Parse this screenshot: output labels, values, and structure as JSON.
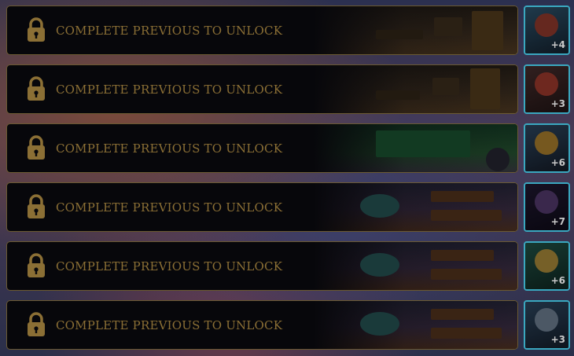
{
  "stages": [
    {
      "label": "COMPLETE PREVIOUS TO UNLOCK",
      "scene": "library",
      "count": "+4",
      "portrait_colors": [
        "#3a6a8a",
        "#b84a3a"
      ]
    },
    {
      "label": "COMPLETE PREVIOUS TO UNLOCK",
      "scene": "library",
      "count": "+3",
      "portrait_colors": [
        "#5a3a3a",
        "#c84a3a"
      ]
    },
    {
      "label": "COMPLETE PREVIOUS TO UNLOCK",
      "scene": "chalk",
      "count": "+6",
      "portrait_colors": [
        "#3a5a7a",
        "#d8a03a"
      ]
    },
    {
      "label": "COMPLETE PREVIOUS TO UNLOCK",
      "scene": "classroom",
      "count": "+7",
      "portrait_colors": [
        "#2a2040",
        "#6a4a8a"
      ]
    },
    {
      "label": "COMPLETE PREVIOUS TO UNLOCK",
      "scene": "classroom",
      "count": "+6",
      "portrait_colors": [
        "#2a6a5a",
        "#d8b04a"
      ]
    },
    {
      "label": "COMPLETE PREVIOUS TO UNLOCK",
      "scene": "classroom",
      "count": "+3",
      "portrait_colors": [
        "#3a5a7a",
        "#8aa0b8"
      ]
    }
  ],
  "colors": {
    "frame_border": "#6b5a32",
    "label_text": "#8b6f35",
    "lock_icon": "#8b6f35",
    "portrait_border": "#3aa8c0"
  }
}
